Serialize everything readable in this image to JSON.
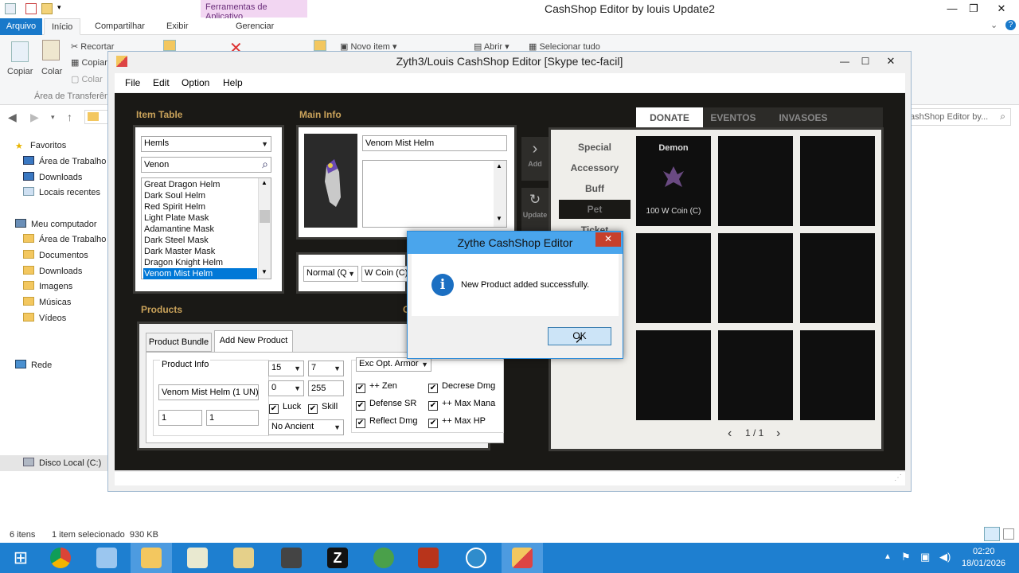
{
  "explorer": {
    "title": "CashShop Editor by louis Update2",
    "context_tab": "Ferramentas de Aplicativo",
    "tabs": [
      "Arquivo",
      "Início",
      "Compartilhar",
      "Exibir",
      "Gerenciar"
    ],
    "ribbon": {
      "copy": "Copiar",
      "paste": "Colar",
      "cut": "Recortar",
      "copy_path": "Copiar",
      "paste_shortcut": "Colar",
      "clipboard_group": "Área de Transferênc",
      "new_item": "Novo item",
      "open": "Abrir",
      "select_all": "Selecionar tudo"
    },
    "search_placeholder": "ashShop Editor by...",
    "nav": {
      "favorites": "Favoritos",
      "fav_items": [
        "Área de Trabalho",
        "Downloads",
        "Locais recentes"
      ],
      "computer": "Meu computador",
      "comp_items": [
        "Área de Trabalho",
        "Documentos",
        "Downloads",
        "Imagens",
        "Músicas",
        "Vídeos",
        "Disco Local (C:)"
      ],
      "network": "Rede"
    },
    "status": {
      "items": "6 itens",
      "selected": "1 item selecionado  930 KB"
    }
  },
  "taskbar": {
    "time": "02:20",
    "date": "18/01/2026"
  },
  "app": {
    "title": "Zyth3/Louis CashShop Editor [Skype tec-facil]",
    "menu": [
      "File",
      "Edit",
      "Option",
      "Help"
    ],
    "item_table": {
      "heading": "Item Table",
      "category": "Hemls",
      "search": "Venon",
      "items": [
        "Great Dragon Helm",
        "Dark Soul Helm",
        "Red Spirit Helm",
        "Light Plate Mask",
        "Adamantine Mask",
        "Dark Steel Mask",
        "Dark Master Mask",
        "Dragon Knight Helm",
        "Venom Mist Helm"
      ],
      "selected_index": 8
    },
    "main_info": {
      "heading": "Main Info",
      "name": "Venom Mist Helm",
      "description": "",
      "quantity_type": "Normal (Qty",
      "coin_type": "W Coin (C)",
      "add_label": "Add",
      "update_label": "Update"
    },
    "products": {
      "heading": "Products",
      "tabs": [
        "Product Bundle",
        "Add New Product"
      ],
      "active_tab": 1,
      "info_label": "Product Info",
      "product_name": "Venom Mist Helm (1 UN)",
      "field_a": "1",
      "field_b": "1",
      "level": "15",
      "option": "7",
      "durability_a": "0",
      "durability_b": "255",
      "luck": "Luck",
      "skill": "Skill",
      "ancient": "No Ancient",
      "exc_select": "Exc Opt. Armor",
      "exc_options": [
        "++ Zen",
        "Decrese Dmg",
        "Defense SR",
        "++ Max Mana",
        "Reflect Dmg",
        "++ Max HP"
      ]
    },
    "shop": {
      "tabs": [
        "DONATE",
        "EVENTOS",
        "INVASOES"
      ],
      "categories": [
        "Special",
        "Accessory",
        "Buff",
        "Pet",
        "Ticket"
      ],
      "selected_category": 3,
      "slot1_name": "Demon",
      "slot1_price": "100 W Coin (C)",
      "pagination": "1 / 1"
    }
  },
  "dialog": {
    "title": "Zythe CashShop Editor",
    "message": "New Product added successfully.",
    "ok": "OK",
    "close": "✕"
  },
  "colors": {
    "accent": "#1979ca",
    "taskbar": "#1e7fd0",
    "section_gold": "#c9a25a",
    "dialog_title": "#4aa5ec"
  }
}
